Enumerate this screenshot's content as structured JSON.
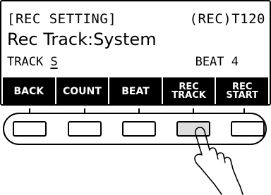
{
  "header": {
    "title": "[REC SETTING]",
    "status": "(REC)T120"
  },
  "main": {
    "setting_line": "Rec Track:System",
    "track_label": "TRACK",
    "track_value": "S",
    "beat_label": "BEAT 4"
  },
  "softkeys": [
    {
      "line1": "BACK",
      "line2": ""
    },
    {
      "line1": "COUNT",
      "line2": ""
    },
    {
      "line1": "BEAT",
      "line2": ""
    },
    {
      "line1": "REC",
      "line2": "TRACK"
    },
    {
      "line1": "REC",
      "line2": "START"
    }
  ],
  "pressed_button": 4,
  "colors": {
    "screen_bg": "#ffffff",
    "text": "#000000",
    "softkey_bg": "#000000",
    "softkey_text": "#ffffff",
    "pressed_button_fill": "#dedede"
  }
}
